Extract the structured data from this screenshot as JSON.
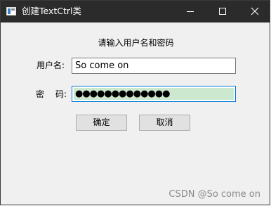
{
  "window": {
    "title": "创建TextCtrl类",
    "controls": {
      "minimize": "minimize-icon",
      "maximize": "maximize-icon",
      "close": "close-icon"
    }
  },
  "form": {
    "prompt": "请输入用户名和密码",
    "username_label": "用户名:",
    "username_value": "So come on",
    "password_label_a": "密",
    "password_label_b": "码:",
    "password_masked": "●●●●●●●●●●●●●"
  },
  "buttons": {
    "ok": "确定",
    "cancel": "取消"
  },
  "watermark": "CSDN @So come on",
  "colors": {
    "titlebar": "#2b2b2b",
    "focus_border": "#0078d7",
    "selection": "#cce8cf"
  }
}
